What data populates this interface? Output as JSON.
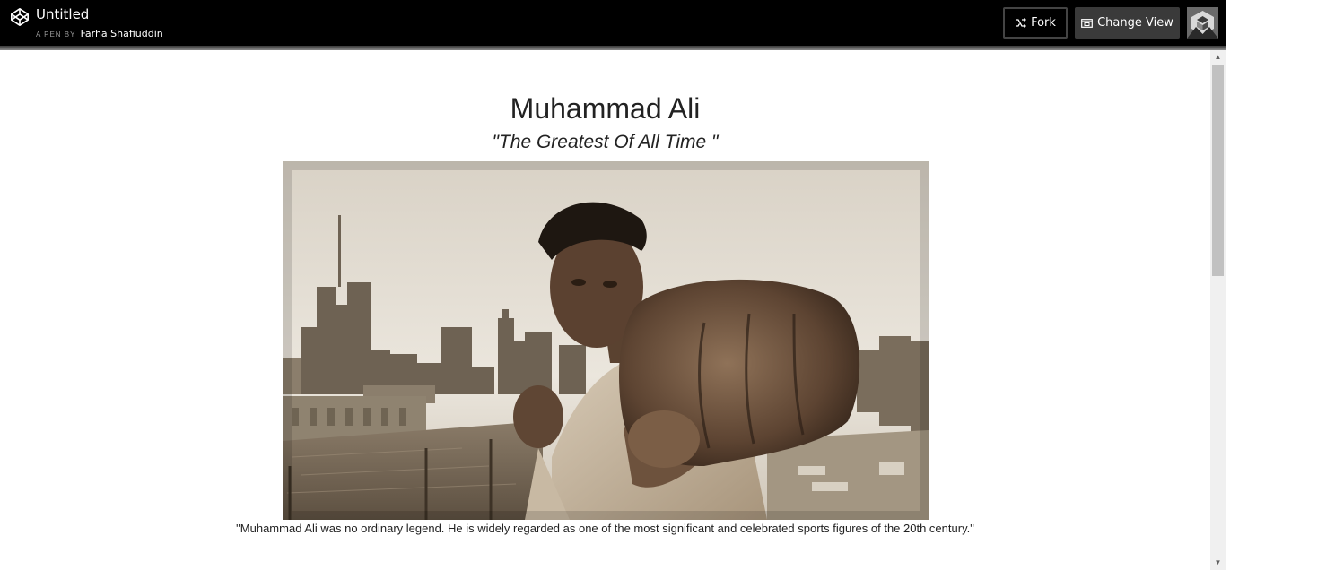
{
  "header": {
    "title": "Untitled",
    "byline_prefix": "A PEN BY",
    "author": "Farha Shafiuddin",
    "fork_label": "Fork",
    "change_view_label": "Change View",
    "icons": {
      "logo": "codepen-logo-icon",
      "fork": "fork-icon",
      "change_view": "change-view-icon",
      "avatar": "user-avatar"
    }
  },
  "content": {
    "title": "Muhammad Ali",
    "subtitle": "\"The Greatest Of All Time \"",
    "caption": "\"Muhammad Ali was no ordinary legend. He is widely regarded as one of the most significant and celebrated sports figures of the 20th century.\""
  },
  "colors": {
    "header_bg": "#000000",
    "change_view_bg": "#3a3a3a",
    "text": "#222222"
  }
}
